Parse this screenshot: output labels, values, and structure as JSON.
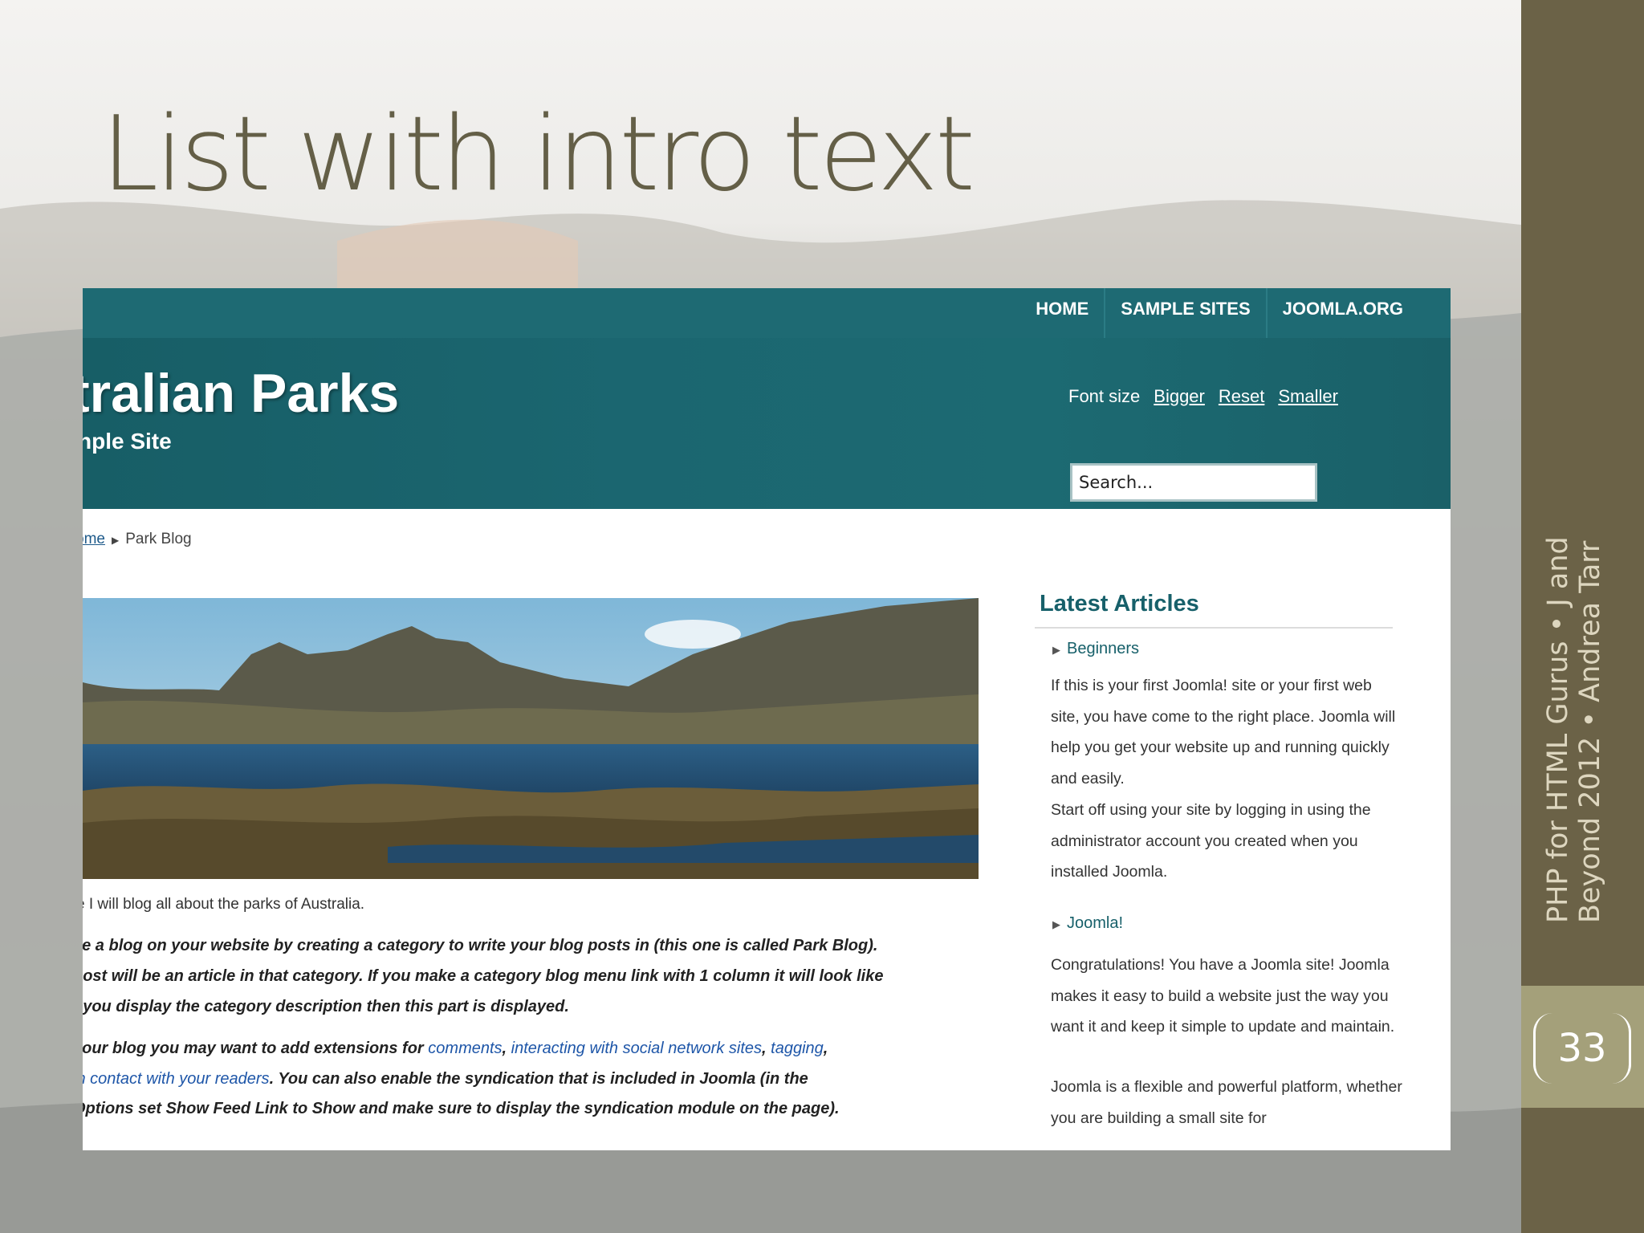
{
  "slide": {
    "title": "List with intro text",
    "caption_line1": "PHP for HTML Gurus • J and",
    "caption_line2": "Beyond 2012 • Andrea Tarr",
    "slide_number": "33"
  },
  "site": {
    "nav": [
      "HOME",
      "SAMPLE SITES",
      "JOOMLA.ORG"
    ],
    "title": "tralian Parks",
    "subtitle": "nple Site",
    "font_size_label": "Font size",
    "font_size_links": [
      "Bigger",
      "Reset",
      "Smaller"
    ],
    "search_placeholder": "Search...",
    "breadcrumb": {
      "home": "ome",
      "current": "Park Blog"
    }
  },
  "article": {
    "intro": "e I will blog all about the parks of Australia.",
    "para1": [
      "ke a blog on your website by creating a category to write your blog posts in (this one is called Park Blog).",
      "post will be an article in that category. If you make a category blog menu link with 1 column it will look like",
      "f you display the category description then this part is displayed."
    ],
    "para2_line1_text": " your blog you may want to add extensions for ",
    "para2_links": [
      "comments",
      "interacting with social network sites",
      "tagging",
      "in contact with your readers"
    ],
    "para2_line2_text": ". You can also enable the syndication that is included in Joomla (in the",
    "para2_line3": "Options set Show Feed Link to Show and make sure to display the syndication module on the page)."
  },
  "sidebar": {
    "title": "Latest Articles",
    "articles": [
      {
        "heading": "Beginners",
        "paragraphs": [
          "If this is your first Joomla! site or your first web site, you have come to the right place. Joomla will help you get your website up and running quickly and easily.",
          "Start off using your site by logging in using the administrator account you created when you installed Joomla."
        ]
      },
      {
        "heading": "Joomla!",
        "paragraphs": [
          "Congratulations! You have a Joomla site! Joomla makes it easy to build a website just the way you want it and keep it simple to update and maintain.",
          "Joomla is a flexible and powerful platform, whether you are building a small site for"
        ]
      }
    ]
  },
  "colors": {
    "title": "#645f47",
    "sidebar": "#6b6247",
    "slide_number_box": "#a4a07a",
    "site_header": "#1b6670",
    "link": "#1e56a8"
  }
}
